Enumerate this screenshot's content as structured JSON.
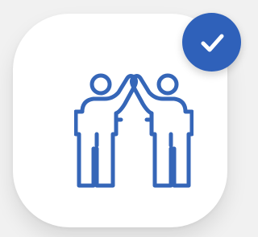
{
  "card": {
    "icon": "high-five-icon",
    "selected": true
  },
  "badge": {
    "icon": "checkmark-icon"
  },
  "colors": {
    "accent": "#2f61ba",
    "icon_stroke": "#3566b8",
    "card_bg": "#ffffff",
    "page_bg": "#f1f1f1"
  }
}
